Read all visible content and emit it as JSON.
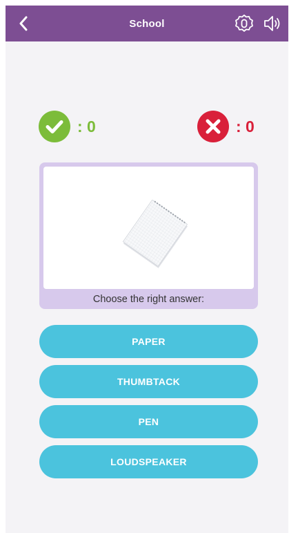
{
  "header": {
    "title": "School",
    "back_icon": "chevron-left-icon",
    "settings_icon": "settings-icon",
    "sound_icon": "speaker-icon"
  },
  "scores": {
    "correct": ": 0",
    "wrong": ": 0",
    "correct_color": "#7cbc3a",
    "wrong_color": "#d9203a"
  },
  "question": {
    "image": "notepad",
    "prompt": "Choose the right answer:"
  },
  "answers": [
    {
      "label": "PAPER"
    },
    {
      "label": "THUMBTACK"
    },
    {
      "label": "PEN"
    },
    {
      "label": "LOUDSPEAKER"
    }
  ],
  "colors": {
    "header": "#7d4e93",
    "card": "#d7c9ec",
    "answer_button": "#4bc3dd",
    "background": "#f4f3f6"
  }
}
